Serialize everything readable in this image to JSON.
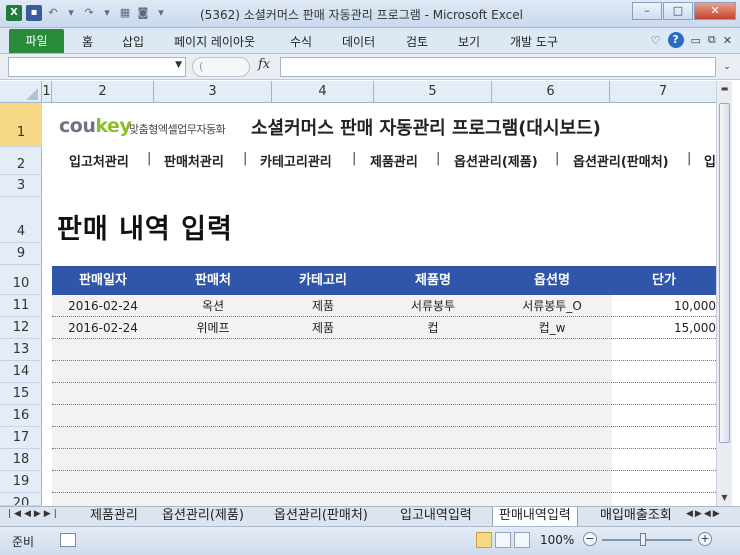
{
  "window": {
    "title": "(5362) 소셜커머스 판매 자동관리 프로그램 - Microsoft Excel",
    "controls": [
      "–",
      "□",
      "✕"
    ]
  },
  "ribbon": {
    "file_tab": "파일",
    "tabs": [
      "홈",
      "삽입",
      "페이지 레이아웃",
      "수식",
      "데이터",
      "검토",
      "보기",
      "개발 도구"
    ]
  },
  "formula_bar": {
    "name_box": "",
    "fx_label": "fx",
    "formula": ""
  },
  "columns": [
    "1",
    "2",
    "3",
    "4",
    "5",
    "6",
    "7"
  ],
  "rows": [
    "1",
    "2",
    "3",
    "4",
    "9",
    "10",
    "11",
    "12",
    "13",
    "14",
    "15",
    "16",
    "17",
    "18",
    "19",
    "20"
  ],
  "dashboard": {
    "logo_prefix": "cou",
    "logo_suffix": "key",
    "tagline": "맞춤형엑셀업무자동화",
    "title": "소셜커머스 판매 자동관리 프로그램(대시보드)",
    "nav": [
      "입고처관리",
      "판매처관리",
      "카테고리관리",
      "제품관리",
      "옵션관리(제품)",
      "옵션관리(판매처)",
      "입"
    ],
    "nav_separator": "|",
    "page_title": "판매 내역 입력"
  },
  "table": {
    "headers": [
      "판매일자",
      "판매처",
      "카테고리",
      "제품명",
      "옵션명",
      "단가"
    ],
    "rows": [
      [
        "2016-02-24",
        "옥션",
        "제품",
        "서류봉투",
        "서류봉투_O",
        "10,000"
      ],
      [
        "2016-02-24",
        "위메프",
        "제품",
        "컵",
        "컵_w",
        "15,000"
      ]
    ]
  },
  "sheet_tabs": [
    "제품관리",
    "옵션관리(제품)",
    "옵션관리(판매처)",
    "입고내역입력",
    "판매내역입력",
    "매입매출조회"
  ],
  "active_sheet": "판매내역입력",
  "status": {
    "ready": "준비",
    "zoom": "100%"
  },
  "colors": {
    "header_blue": "#2f56a8",
    "file_green": "#2a8a3c",
    "logo_green": "#8bbf2a",
    "selected_row": "#f7d885"
  }
}
